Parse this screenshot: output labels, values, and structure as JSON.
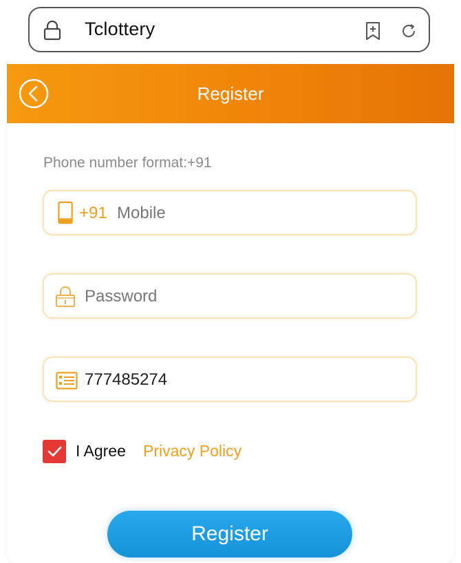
{
  "browser": {
    "site_title": "Tclottery"
  },
  "header": {
    "title": "Register"
  },
  "form": {
    "phone_hint": "Phone number format:+91",
    "mobile": {
      "prefix": "+91",
      "placeholder": "Mobile"
    },
    "password": {
      "placeholder": "Password"
    },
    "invite_code": {
      "value": "777485274"
    },
    "agree": {
      "checked": true,
      "label": "I Agree",
      "policy_link": "Privacy Policy"
    },
    "submit_label": "Register"
  },
  "colors": {
    "header_orange": "#f08508",
    "accent_orange": "#f0a020",
    "field_border": "#fbe3b8",
    "checkbox_red": "#e53935",
    "button_blue": "#1c9be2"
  },
  "icons": {
    "url_lock": "lock-icon",
    "bookmark": "bookmark-add-icon",
    "reload": "reload-icon",
    "back": "back-circle-icon",
    "mobile": "phone-icon",
    "password": "lock-icon",
    "invite": "list-card-icon",
    "checkmark": "check-icon"
  }
}
